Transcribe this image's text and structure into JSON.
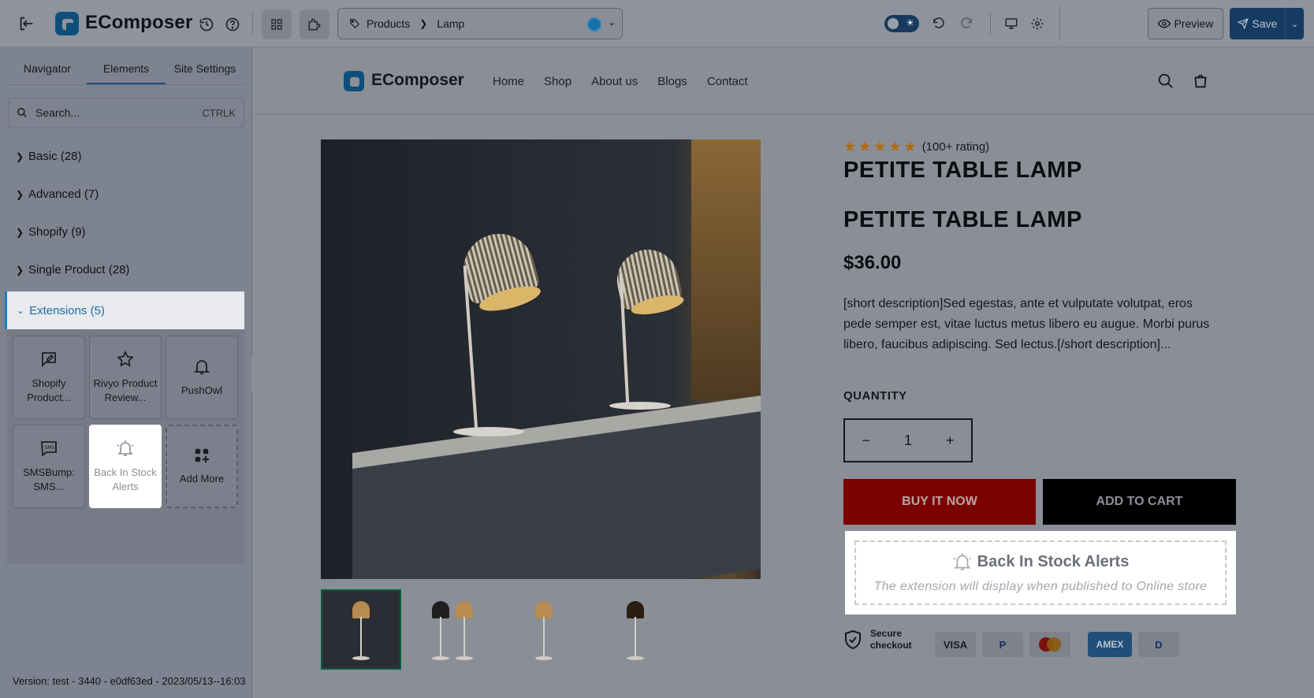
{
  "app": {
    "title": "EComposer",
    "breadcrumb": [
      "Products",
      "Lamp"
    ],
    "preview_label": "Preview",
    "save_label": "Save",
    "dark_mode_icon": "sun-icon"
  },
  "sidebar": {
    "tabs": [
      "Navigator",
      "Elements",
      "Site Settings"
    ],
    "active_tab": "Elements",
    "search_placeholder": "Search...",
    "search_hint": "CTRLK",
    "categories": [
      {
        "label": "Basic (28)"
      },
      {
        "label": "Advanced (7)"
      },
      {
        "label": "Shopify (9)"
      },
      {
        "label": "Single Product (28)"
      }
    ],
    "open_category": "Extensions (5)",
    "extensions": [
      {
        "label": "Shopify Product...",
        "icon": "edit-message-icon"
      },
      {
        "label": "Rivyo Product Review...",
        "icon": "star-icon"
      },
      {
        "label": "PushOwl",
        "icon": "bell-icon"
      },
      {
        "label": "SMSBump: SMS...",
        "icon": "sms-icon"
      },
      {
        "label": "Back In Stock Alerts",
        "icon": "bell-ring-icon"
      },
      {
        "label": "Add More",
        "icon": "grid-plus-icon"
      }
    ],
    "version": "Version: test - 3440 - e0df63ed - 2023/05/13--16:03"
  },
  "store": {
    "brand": "EComposer",
    "nav": [
      "Home",
      "Shop",
      "About us",
      "Blogs",
      "Contact"
    ]
  },
  "product": {
    "rating_text": "(100+ rating)",
    "stars": 5,
    "title_1": "PETITE TABLE LAMP",
    "title_2": "PETITE TABLE LAMP",
    "price": "$36.00",
    "description": "[short description]Sed egestas, ante et vulputate volutpat, eros pede semper est, vitae luctus metus libero eu augue. Morbi purus libero, faucibus adipiscing. Sed lectus.[/short description]...",
    "quantity_label": "QUANTITY",
    "quantity": "1",
    "buy_now": "BUY IT NOW",
    "add_to_cart": "ADD TO CART",
    "bisa_title": "Back In Stock Alerts",
    "bisa_sub": "The extension will display when published to Online store",
    "secure_text": "Secure checkout",
    "payments": [
      "VISA",
      "P",
      "MC",
      "AMEX",
      "D"
    ]
  },
  "colors": {
    "accent": "#1e7fb8",
    "buy_now_bg": "#7b0000",
    "star": "#b06a0f"
  }
}
